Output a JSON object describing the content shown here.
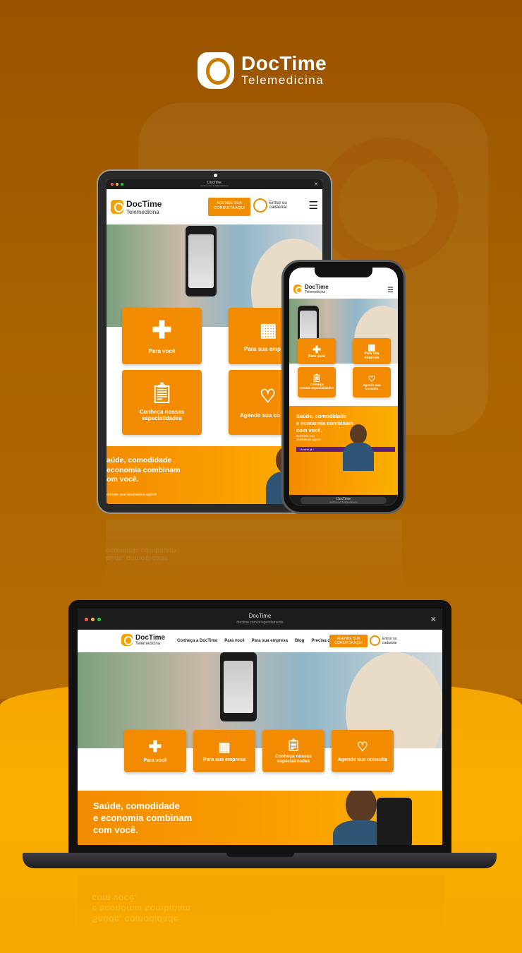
{
  "brand": {
    "name": "DocTime",
    "tagline": "Telemedicina",
    "accent": "#f28b00",
    "background": "#a55c00",
    "highlight": "#fbb000"
  },
  "window": {
    "title": "DocTime",
    "url": "doctime.com.br/agendamento"
  },
  "header": {
    "cta_label_line1": "AGENDE SUA",
    "cta_label_line2": "CONSULTA AQUI",
    "account_line1": "Entrar ou",
    "account_line2": "cadastrar",
    "menu_icon": "hamburger-icon"
  },
  "nav": [
    "Conheça a DocTime",
    "Para você",
    "Para sua empresa",
    "Blog",
    "Precisa de ajuda"
  ],
  "cards": [
    {
      "label_line1": "Para você",
      "label_line2": "",
      "icon": "cross-icon"
    },
    {
      "label_line1": "Para sua empresa",
      "label_line2": "",
      "icon": "building-icon"
    },
    {
      "label_line1": "Conheça nossas",
      "label_line2": "especialidades",
      "icon": "clipboard-icon"
    },
    {
      "label_line1": "Agende sua consulta",
      "label_line2": "",
      "icon": "heart-plus-icon"
    }
  ],
  "tablet_cards": {
    "c2": "Para sua emp",
    "c4": "Agende sua co"
  },
  "phone_cards": [
    {
      "l1": "Para você",
      "l2": ""
    },
    {
      "l1": "Para sua",
      "l2": "empresa"
    },
    {
      "l1": "Conheça",
      "l2": "nossas especialidades"
    },
    {
      "l1": "Agende sua",
      "l2": "consulta"
    }
  ],
  "promo": {
    "line1": "Saúde, comodidade",
    "line2": "e economia combinam",
    "line3": "com você.",
    "tablet_line1": "aúde, comodidade",
    "tablet_line2": "economia combinam",
    "tablet_line3": "om você.",
    "sub": "ontrate sua assinatura agora!",
    "phone_sub1": "Contrate sua",
    "phone_sub2": "assinatura agora!",
    "button": "Assine já"
  },
  "phone_bar": {
    "title": "DocTime",
    "url": "doctime.com.br/agendamento"
  }
}
